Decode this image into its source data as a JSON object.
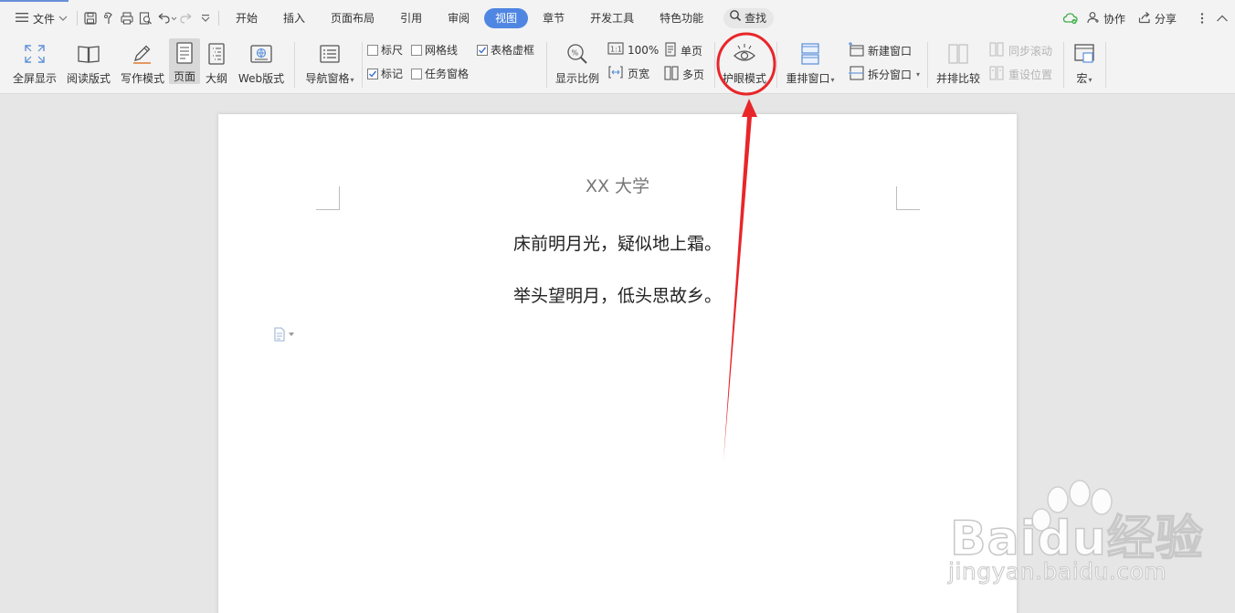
{
  "menubar": {
    "file_label": "文件",
    "tabs": [
      {
        "label": "开始"
      },
      {
        "label": "插入"
      },
      {
        "label": "页面布局"
      },
      {
        "label": "引用"
      },
      {
        "label": "审阅"
      },
      {
        "label": "视图"
      },
      {
        "label": "章节"
      },
      {
        "label": "开发工具"
      },
      {
        "label": "特色功能"
      }
    ],
    "active_tab": "视图",
    "search_label": "查找",
    "collab_label": "协作",
    "share_label": "分享"
  },
  "ribbon": {
    "fullscreen": "全屏显示",
    "reading": "阅读版式",
    "writing": "写作模式",
    "page": "页面",
    "outline": "大纲",
    "web": "Web版式",
    "nav_pane": "导航窗格",
    "checkboxes": {
      "ruler": {
        "label": "标尺",
        "checked": false
      },
      "gridlines": {
        "label": "网格线",
        "checked": false
      },
      "table_dashed": {
        "label": "表格虚框",
        "checked": true
      },
      "marks": {
        "label": "标记",
        "checked": true
      },
      "task_pane": {
        "label": "任务窗格",
        "checked": false
      }
    },
    "zoom": "显示比例",
    "zoom_100": "100%",
    "page_width": "页宽",
    "single_page": "单页",
    "multi_page": "多页",
    "eye_mode": "护眼模式",
    "arrange_windows": "重排窗口",
    "new_window": "新建窗口",
    "split_window": "拆分窗口",
    "side_by_side": "并排比较",
    "sync_scroll": "同步滚动",
    "reset_position": "重设位置",
    "macro": "宏"
  },
  "document": {
    "header": "XX 大学",
    "line1": "床前明月光，疑似地上霜。",
    "line2": "举头望明月，低头思故乡。"
  },
  "watermark": {
    "brand": "Baidu经验",
    "url": "jingyan.baidu.com"
  },
  "colors": {
    "accent": "#4f86e2",
    "annotation": "#e8262a"
  }
}
